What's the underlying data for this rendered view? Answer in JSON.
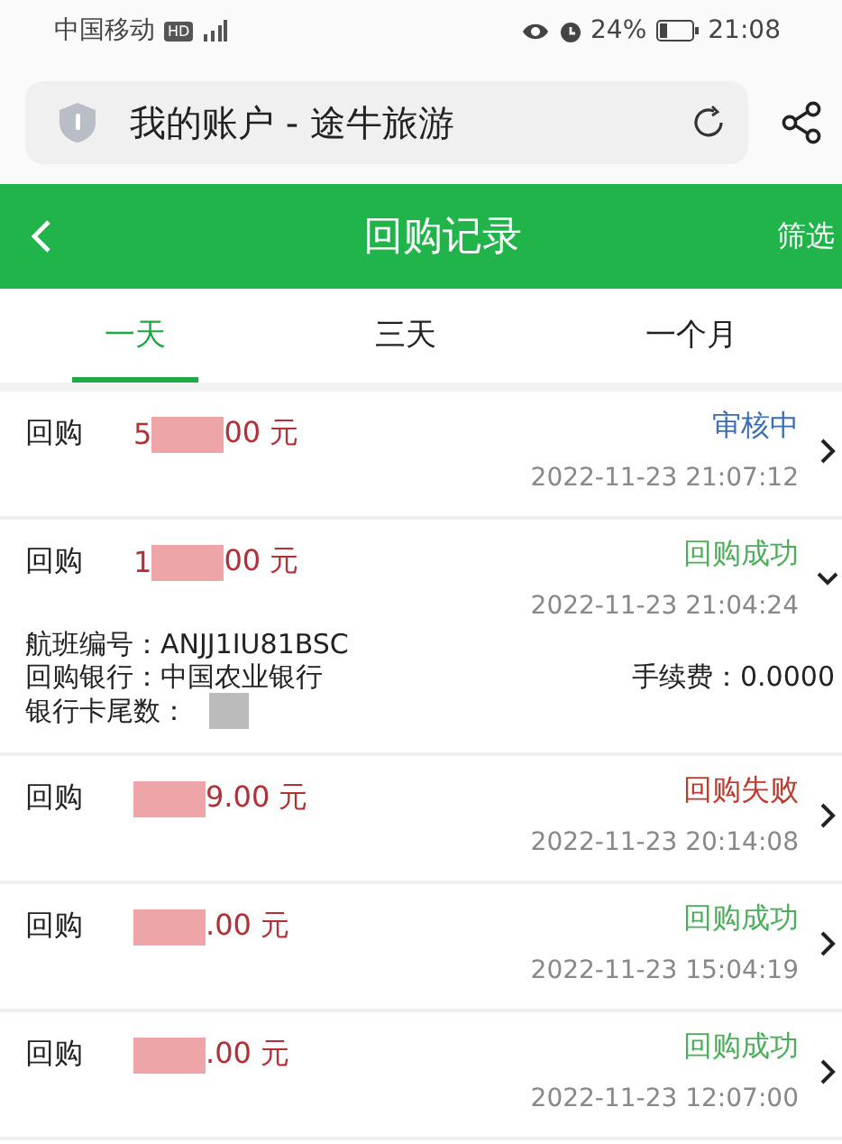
{
  "status_bar": {
    "carrier": "中国移动",
    "hd": "HD",
    "battery": "24%",
    "time": "21:08"
  },
  "browser": {
    "title": "我的账户 - 途牛旅游"
  },
  "header": {
    "title": "回购记录",
    "action": "筛选"
  },
  "tabs": [
    {
      "label": "一天",
      "selected": true
    },
    {
      "label": "三天",
      "selected": false
    },
    {
      "label": "一个月",
      "selected": false
    }
  ],
  "records": [
    {
      "label": "回购",
      "amount_start": "5",
      "amount_end": "00 元",
      "status": "审核中",
      "color": "#3a6db3",
      "time": "2022-11-23 21:07:12",
      "expanded": false
    },
    {
      "label": "回购",
      "amount_start": "1",
      "amount_end": "00 元",
      "status": "回购成功",
      "color": "#4cae5a",
      "time": "2022-11-23 21:04:24",
      "expanded": true,
      "details": {
        "flight": "航班编号：ANJJ1IU81BSC",
        "bank": "回购银行：中国农业银行",
        "fee": "手续费：0.0000",
        "card": "银行卡尾数："
      }
    },
    {
      "label": "回购",
      "amount_end": "9.00 元",
      "status": "回购失败",
      "color": "#c0392b",
      "time": "2022-11-23 20:14:08",
      "expanded": false
    },
    {
      "label": "回购",
      "amount_end": ".00 元",
      "status": "回购成功",
      "color": "#4cae5a",
      "time": "2022-11-23 15:04:19",
      "expanded": false
    },
    {
      "label": "回购",
      "amount_end": ".00 元",
      "status": "回购成功",
      "color": "#4cae5a",
      "time": "2022-11-23 12:07:00",
      "expanded": false
    }
  ]
}
